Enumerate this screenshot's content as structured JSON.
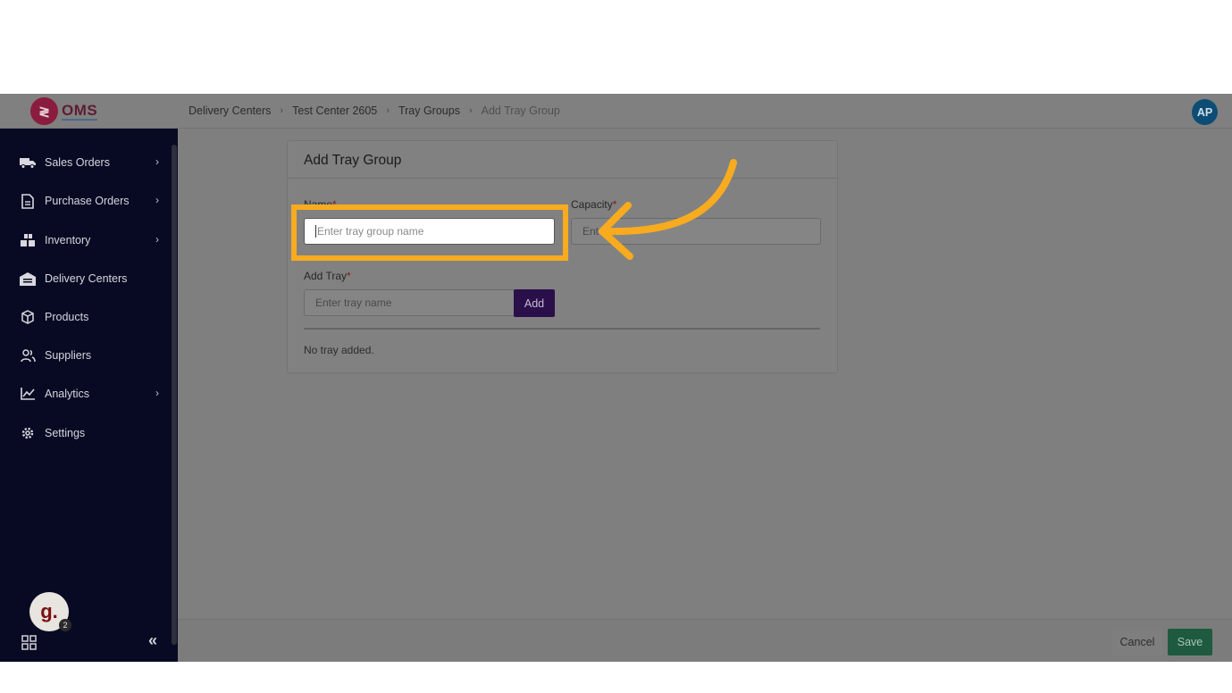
{
  "app": {
    "logo_text": "OMS",
    "logo_glyph": "≷",
    "user_initials": "AP"
  },
  "breadcrumb": [
    "Delivery Centers",
    "Test Center 2605",
    "Tray Groups",
    "Add Tray Group"
  ],
  "sidebar": {
    "items": [
      {
        "label": "Sales Orders",
        "icon": "truck-icon",
        "has_submenu": true
      },
      {
        "label": "Purchase Orders",
        "icon": "document-icon",
        "has_submenu": true
      },
      {
        "label": "Inventory",
        "icon": "boxes-icon",
        "has_submenu": true
      },
      {
        "label": "Delivery Centers",
        "icon": "warehouse-icon",
        "has_submenu": false
      },
      {
        "label": "Products",
        "icon": "package-icon",
        "has_submenu": false
      },
      {
        "label": "Suppliers",
        "icon": "users-icon",
        "has_submenu": false
      },
      {
        "label": "Analytics",
        "icon": "chart-icon",
        "has_submenu": true
      },
      {
        "label": "Settings",
        "icon": "gear-icon",
        "has_submenu": false
      }
    ],
    "help_avatar": "g.",
    "help_badge": "2"
  },
  "form": {
    "title": "Add Tray Group",
    "name_label": "Name",
    "name_placeholder": "Enter tray group name",
    "capacity_label": "Capacity",
    "capacity_placeholder": "Ent",
    "add_tray_label": "Add Tray",
    "tray_placeholder": "Enter tray name",
    "add_button": "Add",
    "empty_message": "No tray added.",
    "required_mark": "*"
  },
  "footer": {
    "cancel": "Cancel",
    "save": "Save"
  },
  "colors": {
    "highlight": "#f8ab1f",
    "sidebar_bg": "#080a24",
    "save_bg": "#1d5a3f",
    "add_bg": "#2b0f4a"
  }
}
